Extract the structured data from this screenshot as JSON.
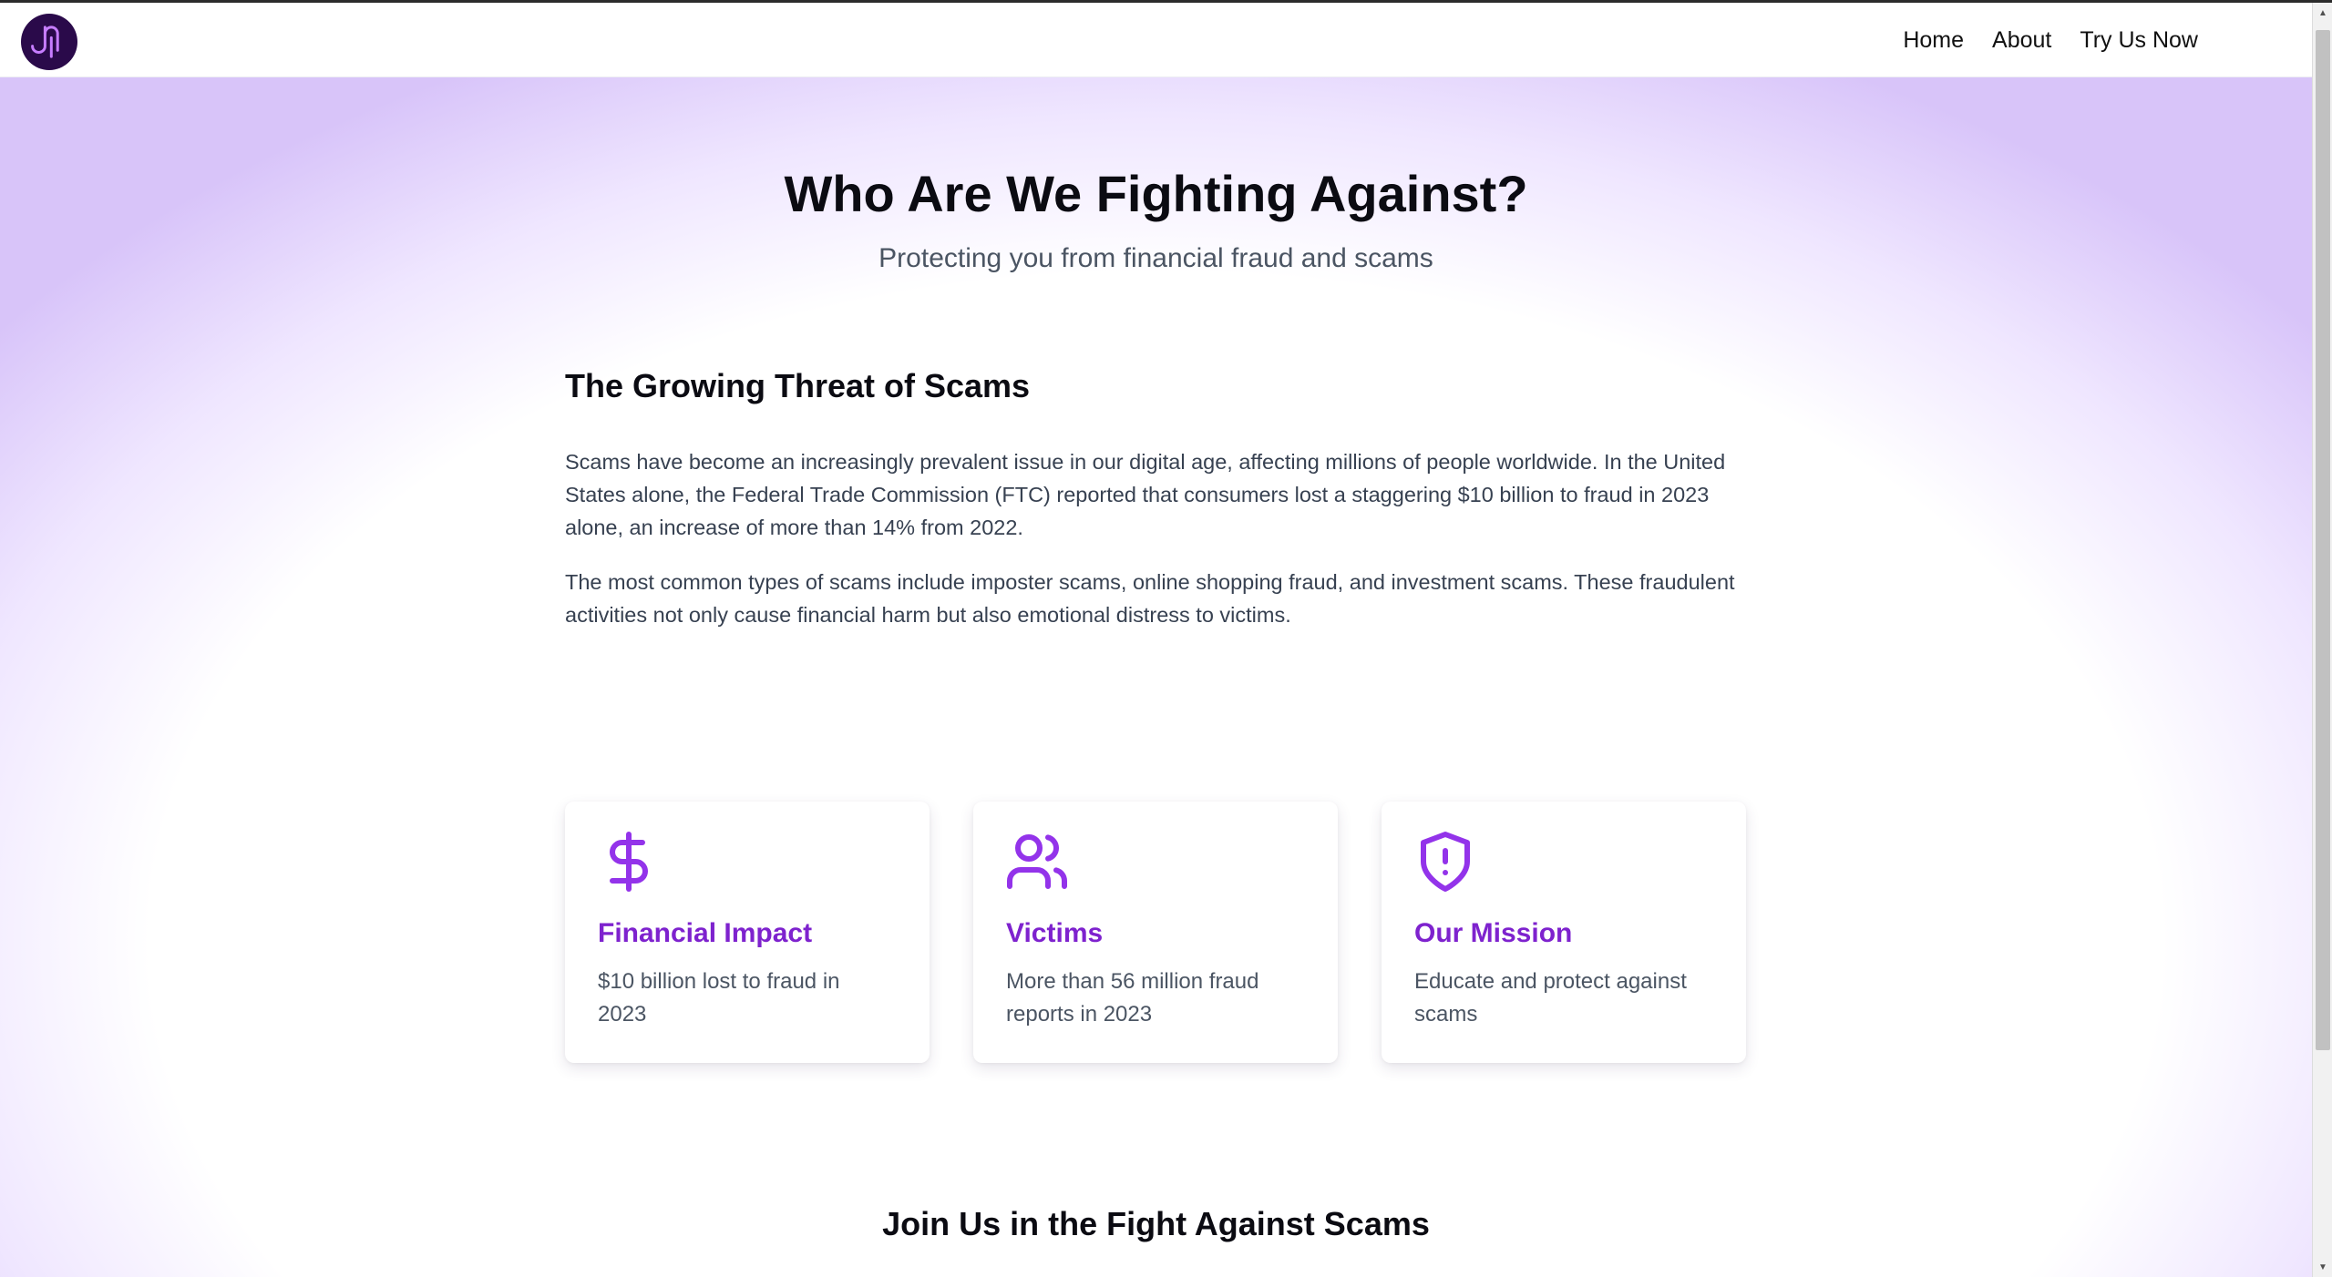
{
  "nav": {
    "logo_icon": "brand-logo-icon",
    "links": [
      "Home",
      "About",
      "Try Us Now"
    ]
  },
  "hero": {
    "title": "Who Are We Fighting Against?",
    "subtitle": "Protecting you from financial fraud and scams"
  },
  "section": {
    "heading": "The Growing Threat of Scams",
    "paragraphs": [
      "Scams have become an increasingly prevalent issue in our digital age, affecting millions of people worldwide. In the United States alone, the Federal Trade Commission (FTC) reported that consumers lost a staggering $10 billion to fraud in 2023 alone, an increase of more than 14% from 2022.",
      "The most common types of scams include imposter scams, online shopping fraud, and investment scams. These fraudulent activities not only cause financial harm but also emotional distress to victims."
    ]
  },
  "cards": [
    {
      "icon": "dollar-icon",
      "title": "Financial Impact",
      "text": "$10 billion lost to fraud in 2023"
    },
    {
      "icon": "users-icon",
      "title": "Victims",
      "text": "More than 56 million fraud reports in 2023"
    },
    {
      "icon": "shield-alert-icon",
      "title": "Our Mission",
      "text": "Educate and protect against scams"
    }
  ],
  "join": {
    "heading": "Join Us in the Fight Against Scams"
  },
  "colors": {
    "accent": "#7e22ce",
    "logo_bg": "#2a0a4a",
    "gradient_edge": "#d8c4f9"
  }
}
